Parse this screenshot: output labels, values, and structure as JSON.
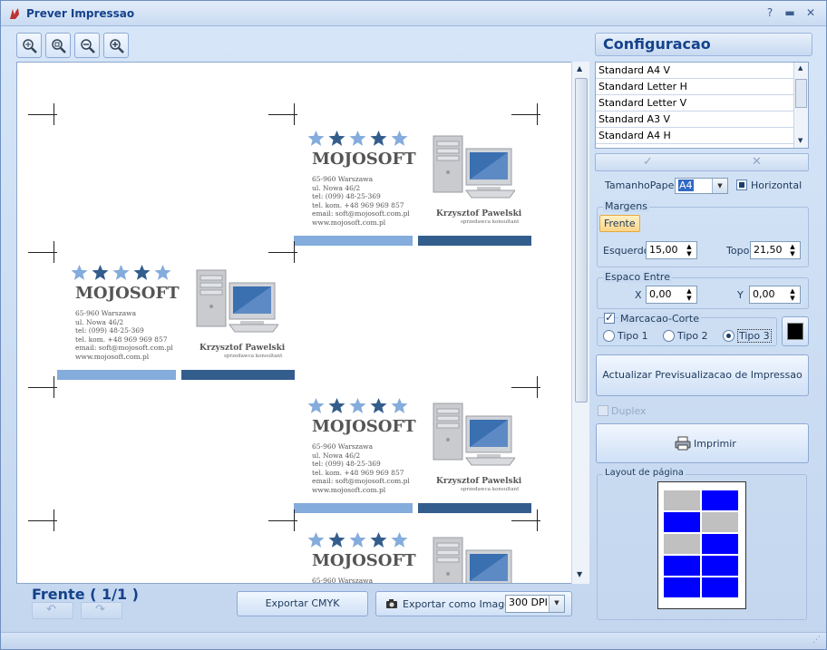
{
  "window": {
    "title": "Prever Impressao"
  },
  "config": {
    "header": "Configuracao",
    "paper_list": [
      "Standard A4 V",
      "Standard Letter H",
      "Standard Letter V",
      "Standard A3 V",
      "Standard A4 H"
    ],
    "paper_size_label": "TamanhoPapel",
    "paper_size_value": "A4",
    "horizontal_label": "Horizontal",
    "margins_title": "Margens",
    "front_tab": "Frente",
    "left_label": "Esquerdo",
    "left_value": "15,00",
    "top_label": "Topo",
    "top_value": "21,50",
    "spacing_title": "Espaco Entre",
    "x_label": "X",
    "x_value": "0,00",
    "y_label": "Y",
    "y_value": "0,00",
    "cutmark_label": "Marcacao-Corte",
    "type1": "Tipo 1",
    "type2": "Tipo 2",
    "type3": "Tipo 3",
    "update_button": "Actualizar Previsualizacao de Impressao",
    "duplex_label": "Duplex",
    "print_button": "Imprimir",
    "layout_title": "Layout de página"
  },
  "card": {
    "brand": "MOJOSOFT",
    "address_a": [
      "65-960 Warszawa",
      "ul. Nowa 46/2",
      "tel: (099) 48-25-369",
      "tel. kom. +48 969 969 857",
      "email: soft@mojosoft.com.pl",
      "www.mojosoft.com.pl"
    ],
    "address_b": [
      "65-960 Warszawa",
      "ul. Nowa 46/2",
      "tel: (099) 48-25-369",
      "tel. kom. +48 969 969 857",
      "email: soft@mojosoft.com.pl",
      "www.mojosoft.com.pl"
    ],
    "person": "Krzysztof Pawelski",
    "role": "sprzedawca konsultant"
  },
  "bottom": {
    "page_indicator": "Frente ( 1/1 )",
    "export_cmyk": "Exportar CMYK",
    "export_image": "Exportar como Imagem",
    "dpi_value": "300 DPI"
  },
  "colors": {
    "star_light": "#84acdc",
    "star_dark": "#335d8c",
    "layout_blue": "#0000ff",
    "layout_gray": "#c0c0c0"
  },
  "layout_grid": [
    [
      "gray",
      "blue"
    ],
    [
      "blue",
      "gray"
    ],
    [
      "gray",
      "blue"
    ],
    [
      "blue",
      "blue"
    ],
    [
      "blue",
      "blue"
    ]
  ]
}
